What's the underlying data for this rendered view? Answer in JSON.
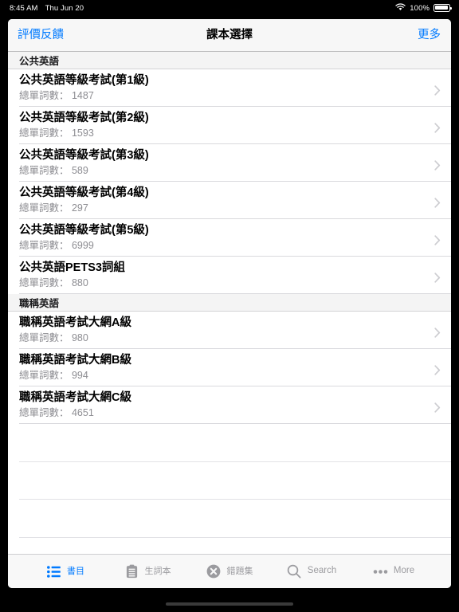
{
  "status_bar": {
    "time": "8:45 AM",
    "date": "Thu Jun 20",
    "battery_percent": "100%",
    "wifi_icon": "wifi-icon",
    "battery_icon": "battery-full-icon"
  },
  "nav_bar": {
    "left_button": "評價反饋",
    "title": "課本選擇",
    "right_button": "更多",
    "accent_color": "#007aff"
  },
  "sections": [
    {
      "header": "公共英語",
      "rows": [
        {
          "title": "公共英語等級考試(第1級)",
          "subtitle": "總單詞數： 1487",
          "accessory_icon": "chevron-right-icon"
        },
        {
          "title": "公共英語等級考試(第2級)",
          "subtitle": "總單詞數： 1593",
          "accessory_icon": "chevron-right-icon"
        },
        {
          "title": "公共英語等級考試(第3級)",
          "subtitle": "總單詞數： 589",
          "accessory_icon": "chevron-right-icon"
        },
        {
          "title": "公共英語等級考試(第4級)",
          "subtitle": "總單詞數： 297",
          "accessory_icon": "chevron-right-icon"
        },
        {
          "title": "公共英語等級考試(第5級)",
          "subtitle": "總單詞數： 6999",
          "accessory_icon": "chevron-right-icon"
        },
        {
          "title": "公共英語PETS3詞組",
          "subtitle": "總單詞數： 880",
          "accessory_icon": "chevron-right-icon"
        }
      ]
    },
    {
      "header": "職稱英語",
      "rows": [
        {
          "title": "職稱英語考試大網A級",
          "subtitle": "總單詞數： 980",
          "accessory_icon": "chevron-right-icon"
        },
        {
          "title": "職稱英語考試大網B級",
          "subtitle": "總單詞數： 994",
          "accessory_icon": "chevron-right-icon"
        },
        {
          "title": "職稱英語考試大網C級",
          "subtitle": "總單詞數： 4651",
          "accessory_icon": "chevron-right-icon"
        }
      ]
    }
  ],
  "empty_row_count": 4,
  "tab_bar": {
    "active_index": 0,
    "active_color": "#007aff",
    "inactive_color": "#9b9b9f",
    "tabs": [
      {
        "label": "書目",
        "icon": "list-bullet-icon",
        "active": true
      },
      {
        "label": "生詞本",
        "icon": "clipboard-icon",
        "active": false
      },
      {
        "label": "錯題集",
        "icon": "circle-x-icon",
        "active": false
      },
      {
        "label": "Search",
        "icon": "search-icon",
        "active": false
      },
      {
        "label": "More",
        "icon": "ellipsis-icon",
        "active": false
      }
    ]
  },
  "home_indicator": "home-indicator"
}
